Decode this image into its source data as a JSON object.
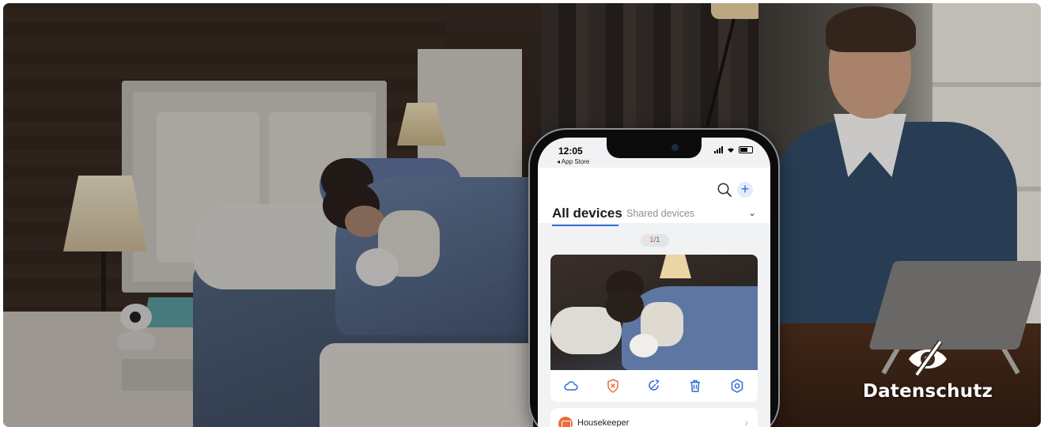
{
  "phone": {
    "status": {
      "time": "12:05",
      "back_label": "◂ App Store"
    },
    "tabs": {
      "active": "All devices",
      "inactive": "Shared devices"
    },
    "pager": {
      "current": "1",
      "total": "/1"
    },
    "device_actions": [
      "cloud-icon",
      "shield-off-icon",
      "share-icon",
      "trash-icon",
      "settings-icon"
    ],
    "list_item": {
      "label": "Housekeeper"
    }
  },
  "privacy_badge": {
    "icon": "eye-slash-icon",
    "label": "Datenschutz"
  },
  "colors": {
    "accent_blue": "#2f6ad9",
    "accent_orange": "#e4572e"
  }
}
